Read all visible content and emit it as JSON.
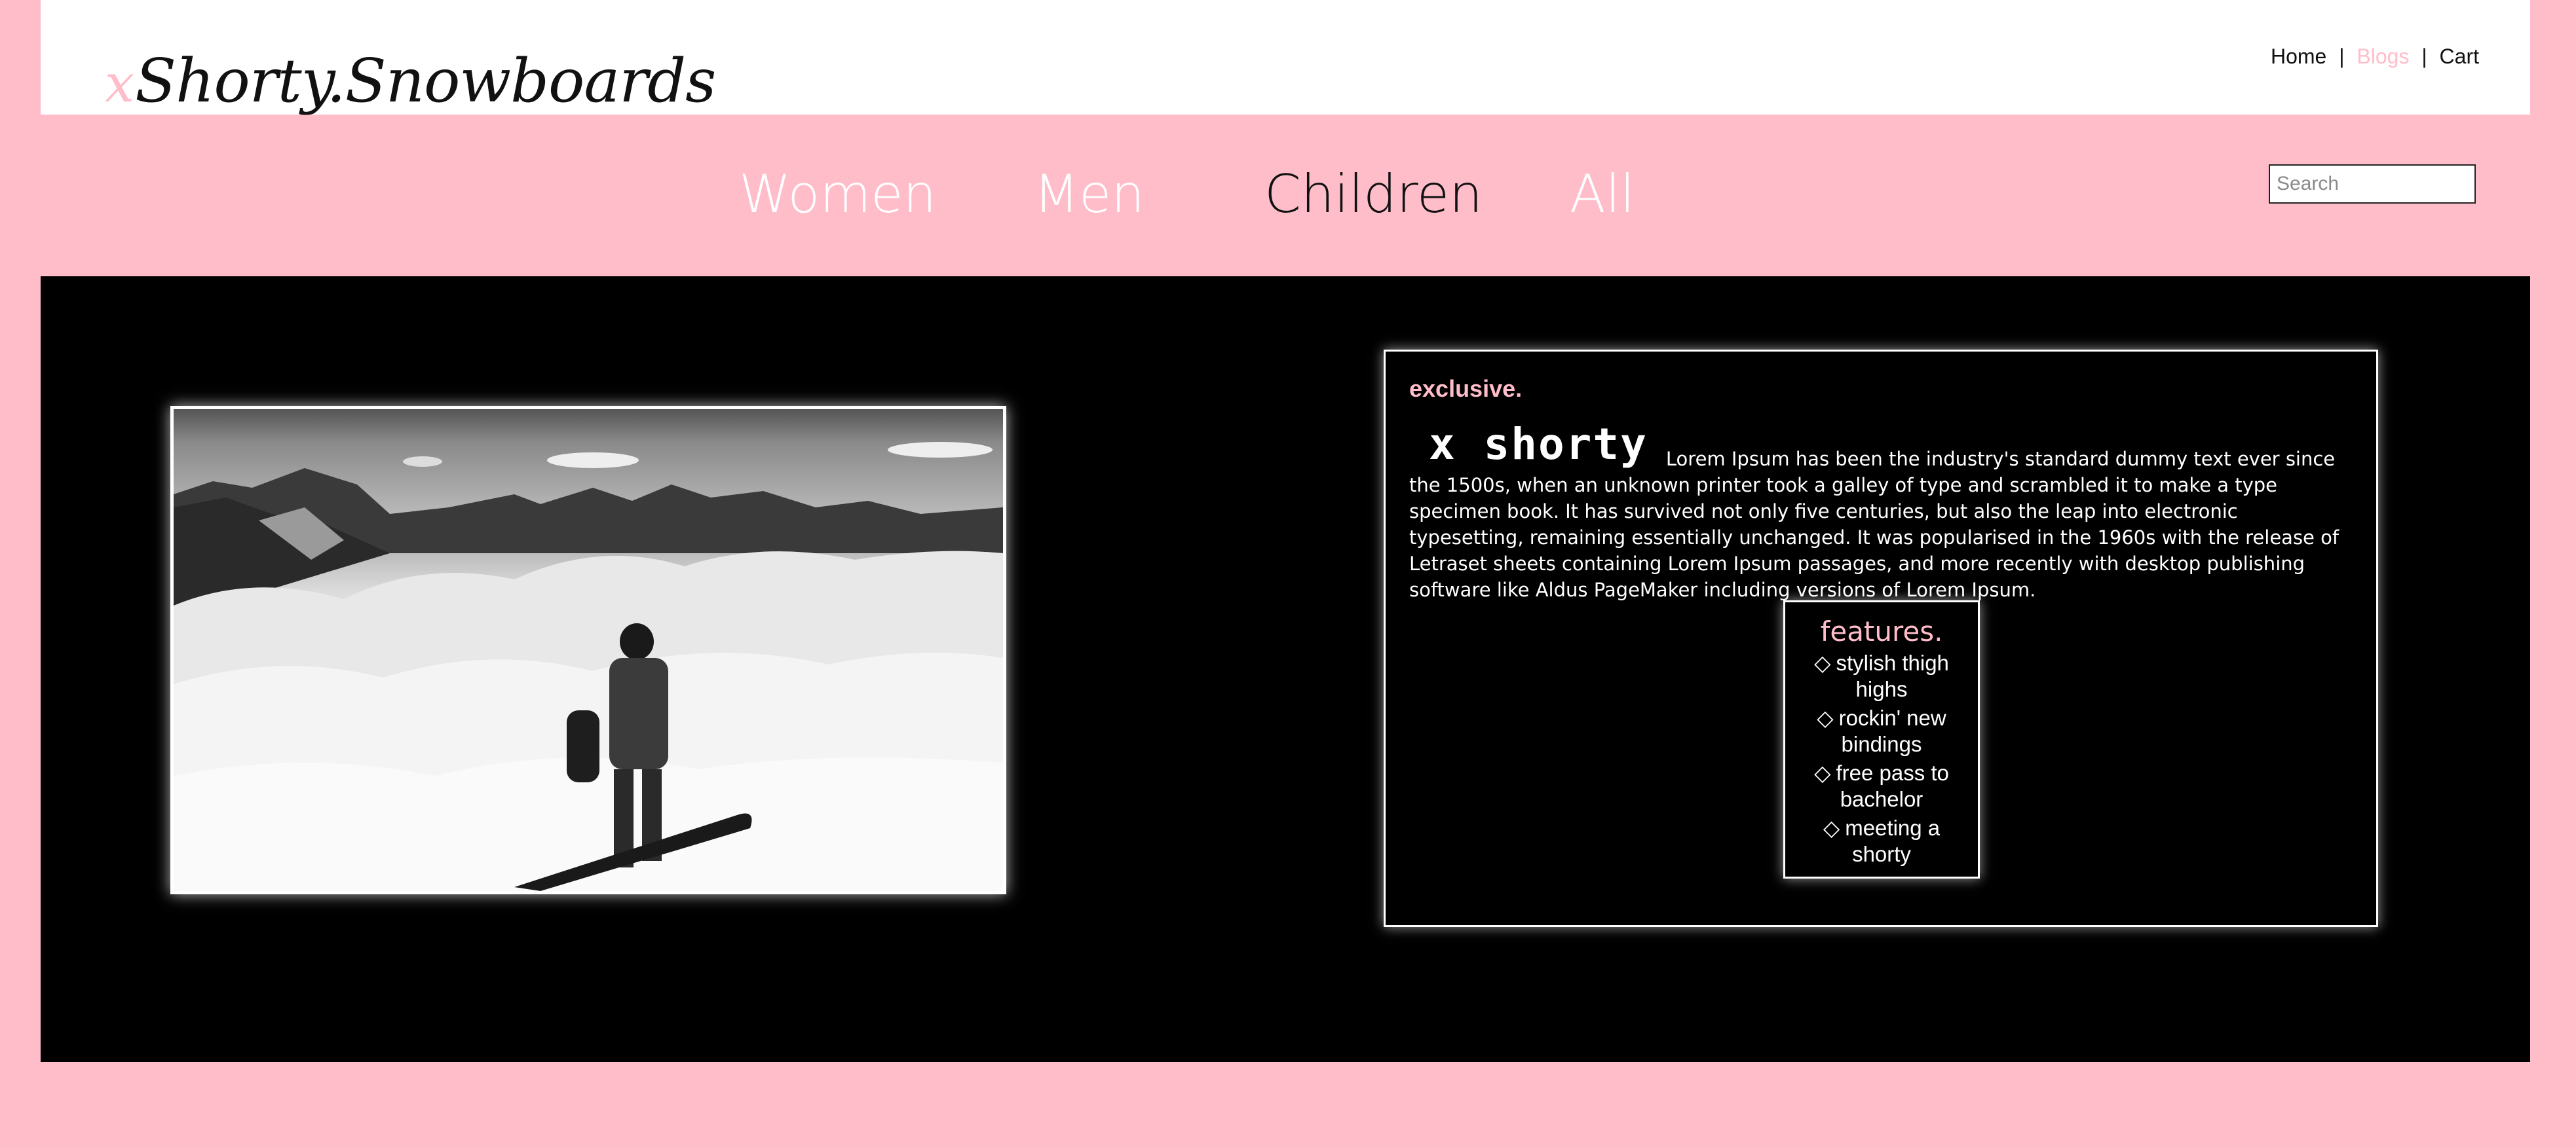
{
  "header": {
    "logo_prefix": "x",
    "logo_text": "Shorty.Snowboards",
    "nav": [
      {
        "label": "Home"
      },
      {
        "label": "Blogs"
      },
      {
        "label": "Cart"
      }
    ],
    "separator": "|"
  },
  "categories": [
    {
      "label": "Women"
    },
    {
      "label": "Men"
    },
    {
      "label": "Children"
    },
    {
      "label": "All"
    }
  ],
  "search": {
    "placeholder": "Search",
    "value": ""
  },
  "featured": {
    "tagline": "exclusive.",
    "brand": "x shorty",
    "description": "Lorem Ipsum has been the industry's standard dummy text ever since the 1500s, when an unknown printer took a galley of type and scrambled it to make a type specimen book. It has survived not only five centuries, but also the leap into electronic typesetting, remaining essentially unchanged. It was popularised in the 1960s with the release of Letraset sheets containing Lorem Ipsum passages, and more recently with desktop publishing software like Aldus PageMaker including versions of Lorem Ipsum.",
    "features_title": "features.",
    "features": [
      "stylish thigh highs",
      "rockin' new bindings",
      "free pass to bachelor",
      "meeting a shorty"
    ],
    "bullet": "◇"
  },
  "colors": {
    "accent": "#ffbdca",
    "background": "#ffbdca",
    "panel": "#000000"
  }
}
